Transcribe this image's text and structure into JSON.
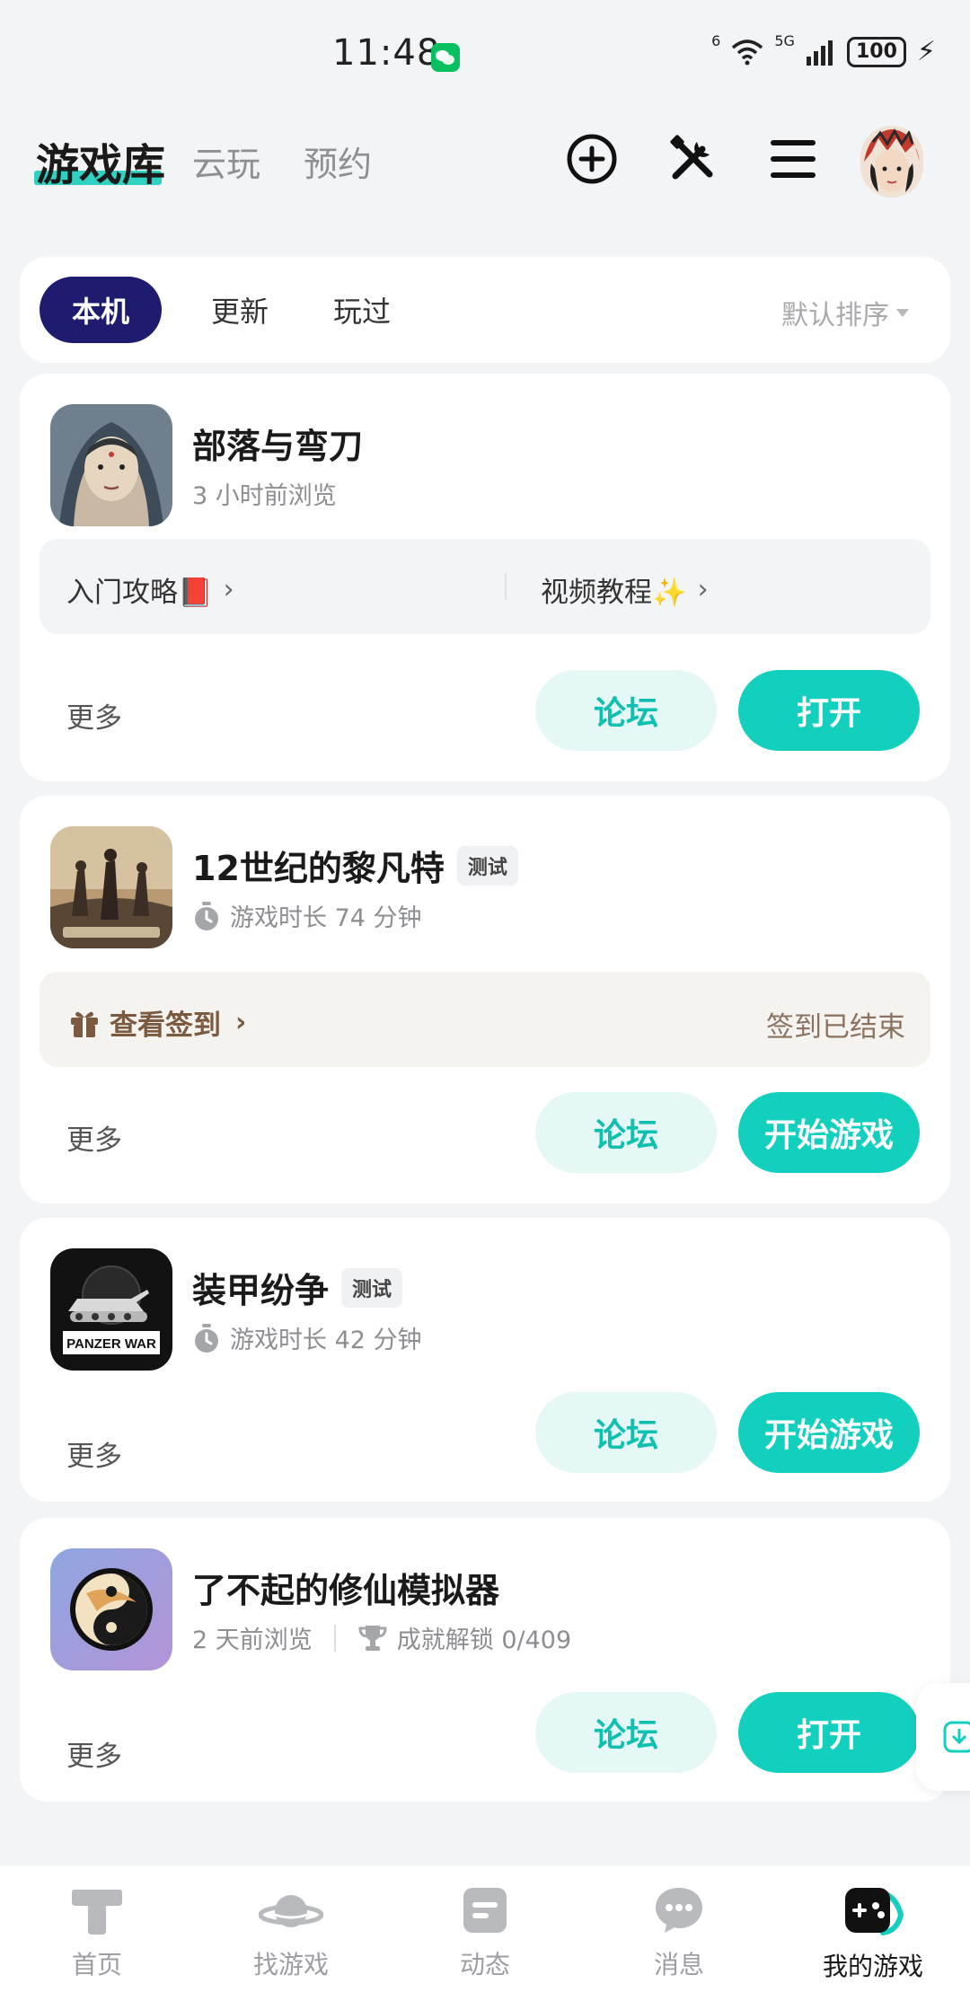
{
  "status_bar": {
    "time": "11:48",
    "wifi_label": "6",
    "cell_label": "5G",
    "battery": "100"
  },
  "header": {
    "tabs": [
      {
        "label": "游戏库"
      },
      {
        "label": "云玩"
      },
      {
        "label": "预约"
      }
    ]
  },
  "filter": {
    "chips": [
      {
        "label": "本机"
      },
      {
        "label": "更新"
      },
      {
        "label": "玩过"
      }
    ],
    "sort_label": "默认排序"
  },
  "games": [
    {
      "title": "部落与弯刀",
      "meta": "3 小时前浏览",
      "guide_label": "入门攻略📕",
      "video_label": "视频教程✨",
      "more": "更多",
      "forum": "论坛",
      "action": "打开"
    },
    {
      "title": "12世纪的黎凡特",
      "tag": "测试",
      "meta": "游戏时长 74 分钟",
      "sign_label": "查看签到",
      "sign_status": "签到已结束",
      "more": "更多",
      "forum": "论坛",
      "action": "开始游戏"
    },
    {
      "title": "装甲纷争",
      "tag": "测试",
      "meta": "游戏时长 42 分钟",
      "icon_text": "PANZER WAR",
      "more": "更多",
      "forum": "论坛",
      "action": "开始游戏"
    },
    {
      "title": "了不起的修仙模拟器",
      "meta": "2 天前浏览",
      "achievement": "成就解锁 0/409",
      "more": "更多",
      "forum": "论坛",
      "action": "打开"
    }
  ],
  "bottom_nav": [
    {
      "label": "首页",
      "icon": "home-icon"
    },
    {
      "label": "找游戏",
      "icon": "planet-icon"
    },
    {
      "label": "动态",
      "icon": "feed-icon"
    },
    {
      "label": "消息",
      "icon": "chat-icon"
    },
    {
      "label": "我的游戏",
      "icon": "gamepad-icon"
    }
  ],
  "colors": {
    "accent": "#12cfbe",
    "chip_active": "#1e1c6e",
    "accent_light": "#e5f8f6"
  }
}
